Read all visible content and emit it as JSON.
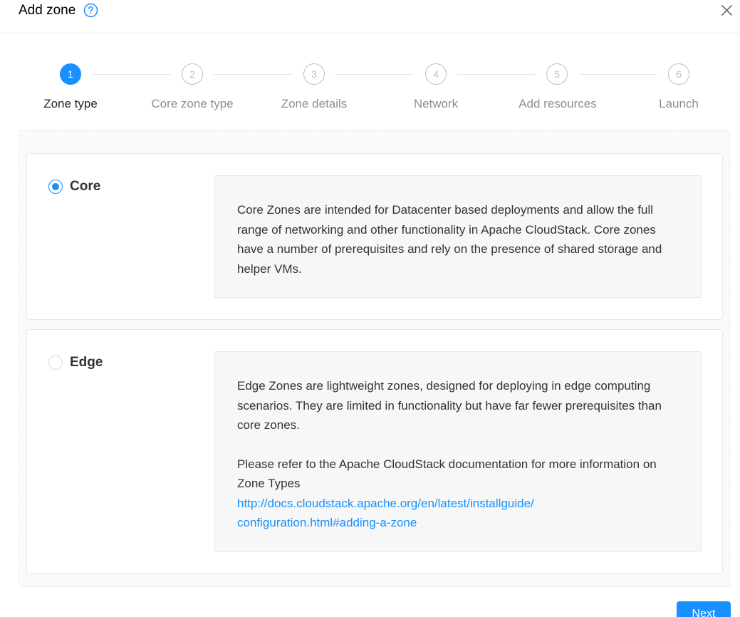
{
  "header": {
    "title": "Add zone",
    "help_icon": "question-circle-icon",
    "close_icon": "close-icon"
  },
  "steps": [
    {
      "number": "1",
      "label": "Zone type",
      "active": true
    },
    {
      "number": "2",
      "label": "Core zone type",
      "active": false
    },
    {
      "number": "3",
      "label": "Zone details",
      "active": false
    },
    {
      "number": "4",
      "label": "Network",
      "active": false
    },
    {
      "number": "5",
      "label": "Add resources",
      "active": false
    },
    {
      "number": "6",
      "label": "Launch",
      "active": false
    }
  ],
  "options": {
    "core": {
      "label": "Core",
      "selected": true,
      "description": "Core Zones are intended for Datacenter based deployments and allow the full range of networking and other functionality in Apache CloudStack. Core zones have a number of prerequisites and rely on the presence of shared storage and helper VMs."
    },
    "edge": {
      "label": "Edge",
      "selected": false,
      "description": "Edge Zones are lightweight zones, designed for deploying in edge computing scenarios. They are limited in functionality but have far fewer prerequisites than core zones.",
      "doc_note": "Please refer to the Apache CloudStack documentation for more information on Zone Types",
      "doc_link": "http://docs.cloudstack.apache.org/en/latest/installguide/configuration.html#adding-a-zone",
      "doc_link_line1": "http://docs.cloudstack.apache.org/en/latest/installguide/",
      "doc_link_line2": "configuration.html#adding-a-zone"
    }
  },
  "footer": {
    "next_label": "Next"
  },
  "colors": {
    "accent": "#1890ff",
    "border": "#e8e8e8",
    "panel_bg": "#fafafa",
    "desc_bg": "#f7f7f7"
  }
}
